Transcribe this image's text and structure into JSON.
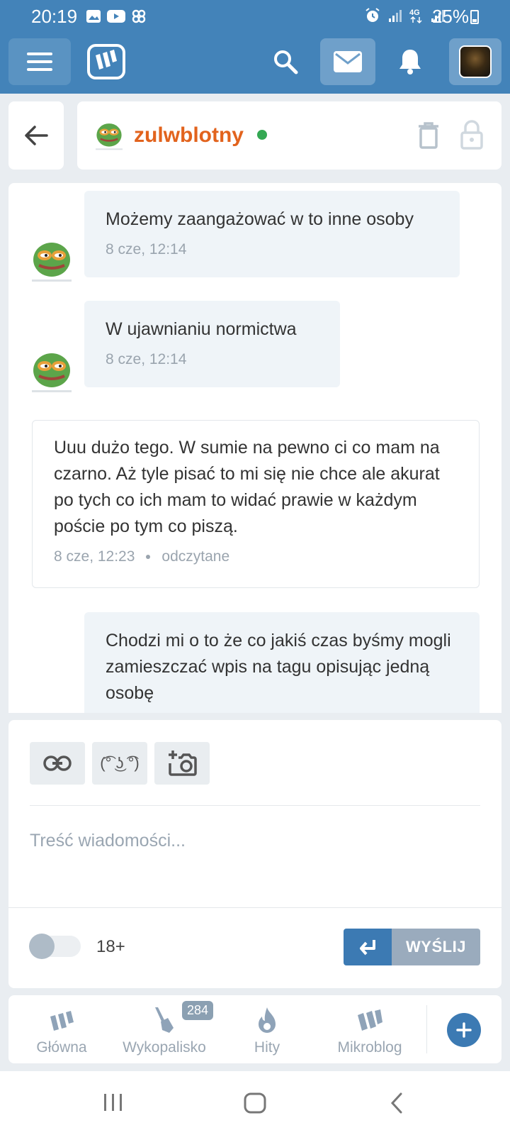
{
  "status_bar": {
    "time": "20:19",
    "battery": "25%",
    "icons_left": [
      "image-icon",
      "youtube-icon",
      "pinwheel-icon"
    ],
    "icons_right": [
      "alarm-icon",
      "signal-icon",
      "4g-icon",
      "signal-icon"
    ]
  },
  "header": {
    "icons": [
      "menu-icon",
      "wykop-logo",
      "search-icon",
      "mail-icon",
      "bell-icon",
      "user-avatar"
    ]
  },
  "conversation": {
    "username": "zulwblotny",
    "online": true,
    "actions": [
      "trash-icon",
      "lock-icon"
    ]
  },
  "messages": [
    {
      "from": "other",
      "text": "Możemy zaangażować w to inne osoby",
      "time": "8 cze, 12:14"
    },
    {
      "from": "other",
      "text": "W ujawnianiu normictwa",
      "time": "8 cze, 12:14"
    },
    {
      "from": "me",
      "text": "Uuu dużo tego. W sumie na pewno ci co mam na czarno. Aż tyle pisać to mi się nie chce ale akurat po tych co ich mam to widać prawie w każdym poście po tym co piszą.",
      "time": "8 cze, 12:23",
      "status": "odczytane"
    },
    {
      "from": "other",
      "text": "Chodzi mi o to że co jakiś czas byśmy mogli zamieszczać wpis na tagu opisując jedną osobę",
      "time": ""
    }
  ],
  "composer": {
    "tools": {
      "link_icon": "link-icon",
      "lenny": "(͡° ͜ʖ ͡°)",
      "photo_icon": "add-photo-icon"
    },
    "placeholder": "Treść wiadomości...",
    "adult_label": "18+",
    "send_label": "WYŚLIJ"
  },
  "bottom_nav": {
    "items": [
      {
        "label": "Główna",
        "icon": "wykop-home-icon"
      },
      {
        "label": "Wykopalisko",
        "icon": "shovel-icon",
        "badge": "284"
      },
      {
        "label": "Hity",
        "icon": "flame-icon"
      },
      {
        "label": "Mikroblog",
        "icon": "microblog-icon"
      }
    ],
    "plus_icon": "plus-icon"
  },
  "colors": {
    "brand_blue": "#4383b9",
    "username_orange": "#e2631d",
    "online_green": "#34a853",
    "send_blue": "#3c7ab3"
  }
}
